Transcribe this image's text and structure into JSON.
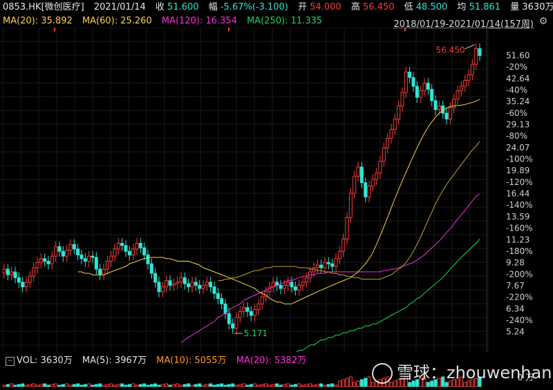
{
  "header": {
    "code": "0853.HK[微创医疗]",
    "date": "2021/01/14",
    "close_label": "收",
    "close": "51.600",
    "change_label": "幅",
    "change": "-5.67%(-3.100)",
    "open_label": "开",
    "open": "54.000",
    "high_label": "高",
    "high": "56.450",
    "low_label": "低",
    "low": "48.500",
    "avg_label": "均",
    "avg": "51.861",
    "volume_label": "量",
    "volume": "3630万"
  },
  "ma_legend": {
    "ma20": "MA(20): 35.892",
    "ma60": "MA(60): 25.260",
    "ma120": "MA(120): 16.354",
    "ma250": "MA(250): 11.335"
  },
  "range_text": "2018/01/19-2021/01/14(157周)",
  "gear_icon": "settings-gear-icon",
  "volume_legend": {
    "vol": "VOL: 3630万",
    "ma5": "MA(5): 3967万",
    "ma10": "MA(10): 5055万",
    "ma20": "MA(20): 5382万"
  },
  "vol_axis_label": "0 万",
  "watermark": "雪球：zhouwenhan",
  "colors": {
    "up": "#ff3b3b",
    "down": "#2ee6d6",
    "ma20": "#ffd24a",
    "ma60": "#c8a030",
    "ma120": "#ff2fd6",
    "ma250": "#1ed760"
  },
  "chart_data": {
    "type": "candlestick",
    "scale": "log",
    "periods": 157,
    "period_unit": "week",
    "x_range": [
      "2018/01/19",
      "2021/01/14"
    ],
    "y_ticks_price": [
      "51.60",
      "42.64",
      "35.24",
      "29.13",
      "24.07",
      "19.89",
      "16.44",
      "13.59",
      "11.23",
      "9.28",
      "7.67",
      "6.34",
      "5.24"
    ],
    "y_ticks_pct": [
      "-20%",
      "-40%",
      "-60%",
      "-80%",
      "-100%",
      "-120%",
      "-140%",
      "-160%",
      "-180%",
      "-200%",
      "-220%",
      "-240%"
    ],
    "annotations": {
      "max_label": "56.450",
      "min_label": "5.171"
    },
    "closes": [
      8.8,
      8.4,
      8.6,
      8.2,
      7.9,
      7.6,
      7.9,
      8.3,
      8.9,
      9.3,
      9.6,
      9.4,
      9.2,
      9.8,
      10.6,
      10.2,
      9.8,
      10.3,
      10.8,
      10.4,
      9.9,
      9.6,
      9.4,
      9.8,
      9.7,
      8.8,
      8.4,
      8.8,
      9.4,
      9.8,
      10.4,
      10.9,
      10.7,
      10.2,
      9.9,
      10.4,
      10.9,
      10.5,
      9.9,
      9.2,
      8.5,
      7.9,
      7.3,
      7.6,
      8.0,
      7.7,
      7.8,
      7.9,
      8.2,
      7.8,
      7.6,
      7.9,
      7.7,
      7.5,
      7.7,
      7.9,
      7.6,
      7.2,
      6.9,
      6.6,
      6.1,
      5.6,
      5.4,
      5.9,
      6.2,
      6.4,
      6.2,
      6.0,
      6.3,
      6.6,
      7.0,
      7.3,
      7.6,
      7.9,
      7.7,
      7.5,
      7.7,
      7.9,
      7.6,
      7.4,
      7.7,
      7.9,
      8.2,
      8.6,
      8.9,
      9.1,
      8.9,
      9.3,
      9.2,
      9.0,
      9.6,
      10.2,
      11.3,
      13.5,
      16.5,
      19.0,
      20.5,
      18.0,
      16.0,
      17.5,
      18.5,
      19.5,
      21.5,
      24.0,
      26.0,
      28.0,
      30.5,
      34.0,
      38.0,
      45.0,
      43.0,
      40.0,
      36.5,
      38.5,
      41.0,
      39.0,
      35.5,
      33.0,
      34.0,
      32.0,
      30.5,
      33.5,
      36.0,
      38.5,
      40.0,
      42.0,
      44.0,
      48.0,
      54.6,
      51.6
    ],
    "ma20": [
      8.6,
      8.6,
      8.5,
      8.5,
      8.4,
      8.4,
      8.4,
      8.4,
      8.5,
      8.6,
      8.7,
      8.8,
      8.9,
      9.0,
      9.2,
      9.3,
      9.4,
      9.5,
      9.6,
      9.7,
      9.7,
      9.7,
      9.7,
      9.7,
      9.6,
      9.6,
      9.5,
      9.4,
      9.4,
      9.4,
      9.4,
      9.3,
      9.2,
      9.1,
      8.9,
      8.8,
      8.7,
      8.6,
      8.5,
      8.4,
      8.3,
      8.2,
      8.1,
      8.0,
      7.9,
      7.8,
      7.7,
      7.6,
      7.5,
      7.3,
      7.2,
      7.1,
      6.9,
      6.8,
      6.7,
      6.7,
      6.6,
      6.6,
      6.6,
      6.7,
      6.8,
      6.9,
      7.0,
      7.1,
      7.2,
      7.3,
      7.4,
      7.5,
      7.6,
      7.7,
      7.8,
      7.9,
      8.0,
      8.1,
      8.2,
      8.4,
      8.6,
      8.9,
      9.2,
      9.6,
      10.1,
      10.8,
      11.6,
      12.5,
      13.5,
      14.6,
      15.8,
      17.0,
      18.3,
      19.6,
      21.0,
      22.5,
      24.0,
      25.6,
      27.1,
      28.5,
      29.8,
      31.0,
      32.0,
      32.8,
      33.4,
      33.8,
      34.0,
      34.1,
      34.2,
      34.4,
      34.7,
      35.0,
      35.4,
      35.9
    ],
    "ma60": [
      8.0,
      8.0,
      8.1,
      8.1,
      8.2,
      8.2,
      8.3,
      8.4,
      8.5,
      8.6,
      8.7,
      8.7,
      8.8,
      8.9,
      8.9,
      9.0,
      9.0,
      9.0,
      9.0,
      9.0,
      9.0,
      9.0,
      8.9,
      8.9,
      8.9,
      8.8,
      8.8,
      8.7,
      8.7,
      8.6,
      8.6,
      8.5,
      8.5,
      8.4,
      8.4,
      8.3,
      8.3,
      8.2,
      8.2,
      8.1,
      8.1,
      8.1,
      8.1,
      8.1,
      8.1,
      8.2,
      8.3,
      8.4,
      8.6,
      8.8,
      9.0,
      9.3,
      9.7,
      10.2,
      10.8,
      11.5,
      12.3,
      13.2,
      14.1,
      15.1,
      16.0,
      16.9,
      17.7,
      18.5,
      19.3,
      20.1,
      20.9,
      21.8,
      22.7,
      23.6,
      24.4,
      25.3
    ],
    "ma120": [
      4.8,
      4.9,
      5.0,
      5.1,
      5.2,
      5.3,
      5.4,
      5.5,
      5.6,
      5.7,
      5.9,
      6.0,
      6.1,
      6.3,
      6.4,
      6.5,
      6.6,
      6.8,
      6.9,
      7.0,
      7.1,
      7.2,
      7.3,
      7.4,
      7.5,
      7.6,
      7.7,
      7.8,
      7.9,
      8.0,
      8.0,
      8.1,
      8.2,
      8.3,
      8.3,
      8.4,
      8.4,
      8.5,
      8.5,
      8.5,
      8.6,
      8.6,
      8.6,
      8.6,
      8.6,
      8.6,
      8.6,
      8.6,
      8.6,
      8.6,
      8.6,
      8.6,
      8.6,
      8.6,
      8.6,
      8.7,
      8.7,
      8.8,
      8.8,
      8.9,
      9.0,
      9.1,
      9.2,
      9.3,
      9.5,
      9.7,
      9.9,
      10.2,
      10.5,
      10.8,
      11.1,
      11.5,
      11.9,
      12.3,
      12.8,
      13.3,
      13.8,
      14.3,
      14.9,
      15.5,
      16.1,
      16.4
    ],
    "ma250": [
      4.3,
      4.3,
      4.4,
      4.5,
      4.5,
      4.6,
      4.7,
      4.7,
      4.8,
      4.9,
      4.9,
      5.0,
      5.0,
      5.1,
      5.1,
      5.2,
      5.2,
      5.3,
      5.3,
      5.4,
      5.4,
      5.5,
      5.5,
      5.6,
      5.6,
      5.7,
      5.8,
      5.9,
      6.0,
      6.1,
      6.2,
      6.3,
      6.4,
      6.6,
      6.7,
      6.9,
      7.0,
      7.2,
      7.4,
      7.6,
      7.8,
      8.0,
      8.2,
      8.5,
      8.8,
      9.1,
      9.4,
      9.7,
      10.0,
      10.3,
      10.6,
      10.9,
      11.3
    ]
  }
}
